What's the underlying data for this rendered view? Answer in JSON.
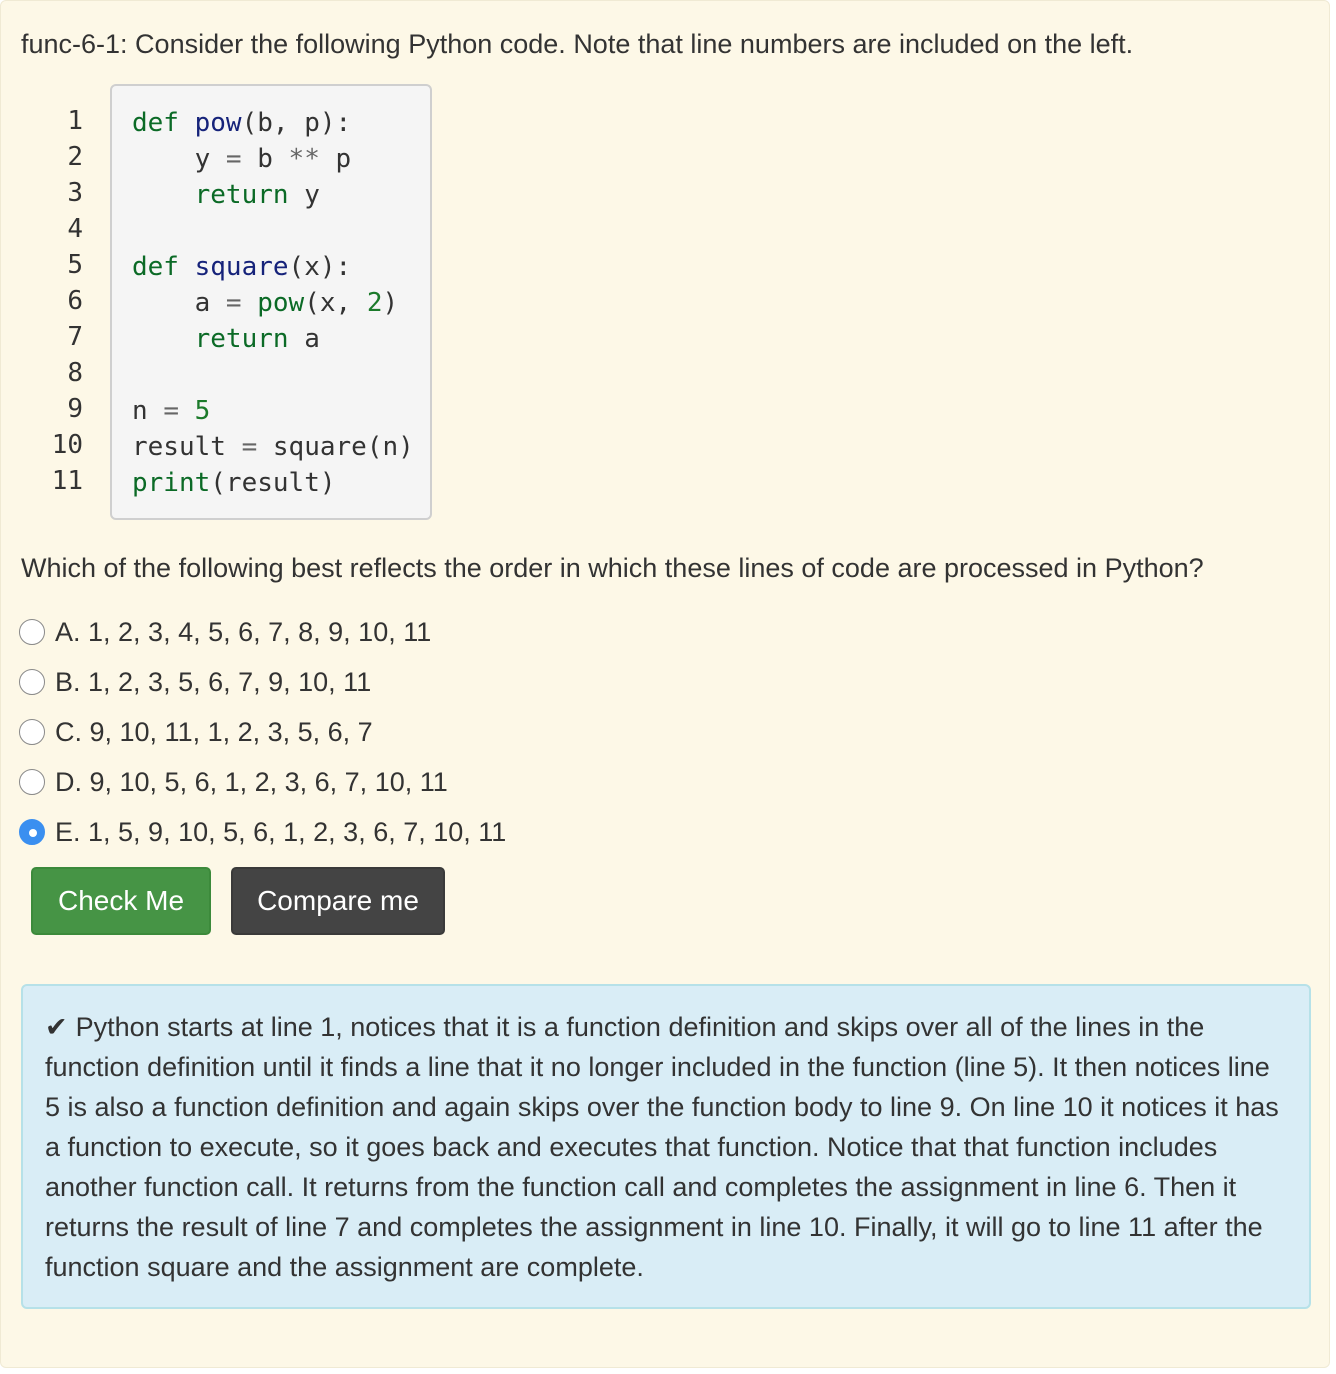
{
  "question": {
    "text": "func-6-1: Consider the following Python code. Note that line numbers are included on the left."
  },
  "code": {
    "line_numbers": [
      "1",
      "2",
      "3",
      "4",
      "5",
      "6",
      "7",
      "8",
      "9",
      "10",
      "11"
    ],
    "lines": [
      [
        {
          "t": "def",
          "c": "kw"
        },
        {
          "t": " "
        },
        {
          "t": "pow",
          "c": "fn"
        },
        {
          "t": "(b, p):"
        }
      ],
      [
        {
          "t": "    y "
        },
        {
          "t": "=",
          "c": "op"
        },
        {
          "t": " b "
        },
        {
          "t": "**",
          "c": "op"
        },
        {
          "t": " p"
        }
      ],
      [
        {
          "t": "    "
        },
        {
          "t": "return",
          "c": "kw"
        },
        {
          "t": " y"
        }
      ],
      [
        {
          "t": ""
        }
      ],
      [
        {
          "t": "def",
          "c": "kw"
        },
        {
          "t": " "
        },
        {
          "t": "square",
          "c": "fn"
        },
        {
          "t": "(x):"
        }
      ],
      [
        {
          "t": "    a "
        },
        {
          "t": "=",
          "c": "op"
        },
        {
          "t": " "
        },
        {
          "t": "pow",
          "c": "kw"
        },
        {
          "t": "(x, "
        },
        {
          "t": "2",
          "c": "num"
        },
        {
          "t": ")"
        }
      ],
      [
        {
          "t": "    "
        },
        {
          "t": "return",
          "c": "kw"
        },
        {
          "t": " a"
        }
      ],
      [
        {
          "t": ""
        }
      ],
      [
        {
          "t": "n "
        },
        {
          "t": "=",
          "c": "op"
        },
        {
          "t": " "
        },
        {
          "t": "5",
          "c": "num"
        }
      ],
      [
        {
          "t": "result "
        },
        {
          "t": "=",
          "c": "op"
        },
        {
          "t": " square(n)"
        }
      ],
      [
        {
          "t": "print",
          "c": "kw"
        },
        {
          "t": "(result)"
        }
      ]
    ]
  },
  "prompt": "Which of the following best reflects the order in which these lines of code are processed in Python?",
  "options": [
    {
      "label": "A. 1, 2, 3, 4, 5, 6, 7, 8, 9, 10, 11",
      "selected": false
    },
    {
      "label": "B. 1, 2, 3, 5, 6, 7, 9, 10, 11",
      "selected": false
    },
    {
      "label": "C. 9, 10, 11, 1, 2, 3, 5, 6, 7",
      "selected": false
    },
    {
      "label": "D. 9, 10, 5, 6, 1, 2, 3, 6, 7, 10, 11",
      "selected": false
    },
    {
      "label": "E. 1, 5, 9, 10, 5, 6, 1, 2, 3, 6, 7, 10, 11",
      "selected": true
    }
  ],
  "buttons": {
    "check_label": "Check Me",
    "compare_label": "Compare me"
  },
  "feedback": {
    "icon": "checkmark-icon",
    "mark": "✔",
    "text": "Python starts at line 1, notices that it is a function definition and skips over all of the lines in the function definition until it finds a line that it no longer included in the function (line 5). It then notices line 5 is also a function definition and again skips over the function body to line 9. On line 10 it notices it has a function to execute, so it goes back and executes that function. Notice that that function includes another function call. It returns from the function call and completes the assignment in line 6. Then it returns the result of line 7 and completes the assignment in line 10. Finally, it will go to line 11 after the function square and the assignment are complete."
  },
  "colors": {
    "card_bg": "#fdf8e7",
    "check_button": "#469445",
    "compare_button": "#444444",
    "feedback_bg": "#d9edf6",
    "radio_selected": "#3a8ff0"
  }
}
